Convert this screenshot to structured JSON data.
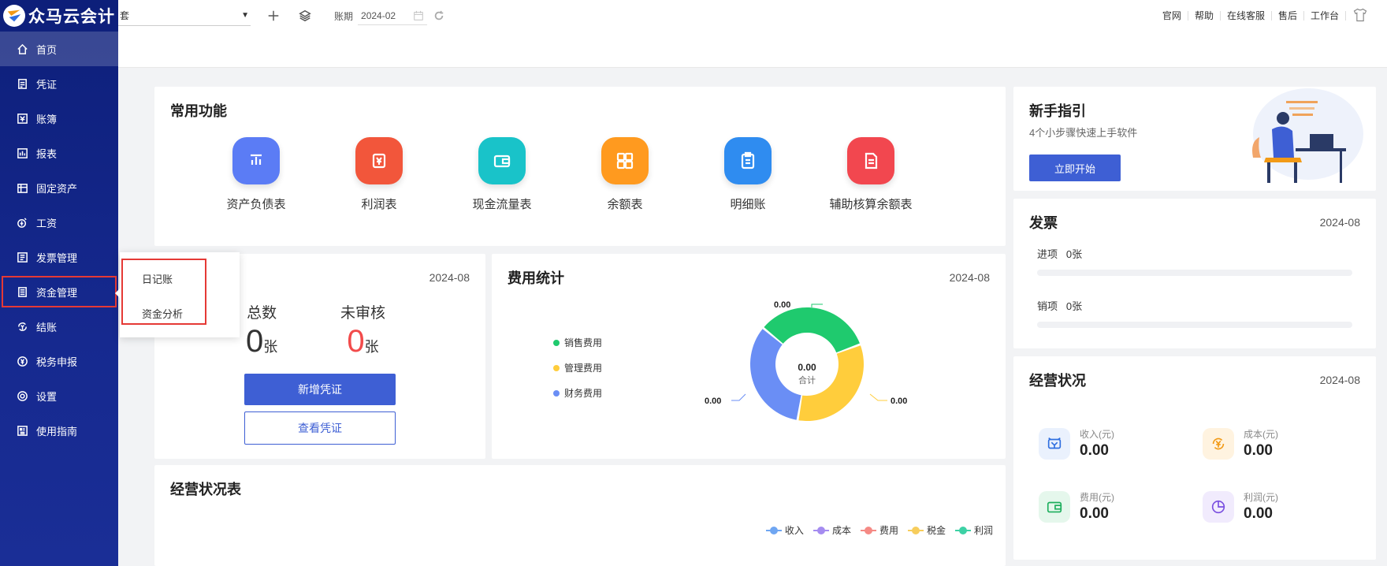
{
  "app": {
    "brand": "众马云会计"
  },
  "sidebar": {
    "items": [
      {
        "label": "首页",
        "icon": "home-icon"
      },
      {
        "label": "凭证",
        "icon": "voucher-icon"
      },
      {
        "label": "账簿",
        "icon": "ledger-icon"
      },
      {
        "label": "报表",
        "icon": "report-icon"
      },
      {
        "label": "固定资产",
        "icon": "fixed-asset-icon"
      },
      {
        "label": "工资",
        "icon": "salary-icon"
      },
      {
        "label": "发票管理",
        "icon": "invoice-icon"
      },
      {
        "label": "资金管理",
        "icon": "fund-icon"
      },
      {
        "label": "结账",
        "icon": "checkout-icon"
      },
      {
        "label": "税务申报",
        "icon": "tax-icon"
      },
      {
        "label": "设置",
        "icon": "gear-icon"
      },
      {
        "label": "使用指南",
        "icon": "guide-icon"
      }
    ]
  },
  "topbar": {
    "account_select_value": "套",
    "period_label": "账期",
    "period_value": "2024-02",
    "links": [
      "官网",
      "帮助",
      "在线客服",
      "售后",
      "工作台"
    ]
  },
  "popup": {
    "items": [
      "日记账",
      "资金分析"
    ]
  },
  "common": {
    "title": "常用功能",
    "functions": [
      {
        "label": "资产负债表",
        "color": "#5b7cf5"
      },
      {
        "label": "利润表",
        "color": "#f2563b"
      },
      {
        "label": "现金流量表",
        "color": "#19c3c9"
      },
      {
        "label": "余额表",
        "color": "#ff9a1f"
      },
      {
        "label": "明细账",
        "color": "#2f8cf0"
      },
      {
        "label": "辅助核算余额表",
        "color": "#f2474f"
      }
    ]
  },
  "guide": {
    "title": "新手指引",
    "subtitle": "4个小步骤快速上手软件",
    "button": "立即开始"
  },
  "invoice": {
    "title": "发票",
    "date": "2024-08",
    "rows": [
      {
        "label": "进项",
        "value": "0张"
      },
      {
        "label": "销项",
        "value": "0张"
      }
    ]
  },
  "biz": {
    "title": "经营状况",
    "date": "2024-08",
    "items": [
      {
        "label": "收入(元)",
        "value": "0.00",
        "icon": "income-icon",
        "color": "#2f6fe0",
        "bg": "#eaf1fd"
      },
      {
        "label": "成本(元)",
        "value": "0.00",
        "icon": "cost-icon",
        "color": "#f29a16",
        "bg": "#fff3e0"
      },
      {
        "label": "费用(元)",
        "value": "0.00",
        "icon": "wallet-icon",
        "color": "#1cae5c",
        "bg": "#e5f7ec"
      },
      {
        "label": "利润(元)",
        "value": "0.00",
        "icon": "profit-icon",
        "color": "#7a4fe0",
        "bg": "#f1ebfd"
      }
    ]
  },
  "voucher": {
    "date": "2024-08",
    "total_label": "总数",
    "total_value": "0",
    "total_unit": "张",
    "unaudited_label": "未审核",
    "unaudited_value": "0",
    "unaudited_unit": "张",
    "new_button": "新增凭证",
    "view_button": "查看凭证"
  },
  "expense": {
    "title": "费用统计",
    "date": "2024-08",
    "legend": [
      {
        "label": "销售费用",
        "color": "#1fca6e"
      },
      {
        "label": "管理费用",
        "color": "#ffcd3c"
      },
      {
        "label": "财务费用",
        "color": "#6a8ef5"
      }
    ],
    "center_value": "0.00",
    "center_label": "合计",
    "slice_labels": [
      "0.00",
      "0.00",
      "0.00"
    ]
  },
  "ops": {
    "title": "经营状况表",
    "legend": [
      {
        "label": "收入",
        "color": "#6fa6f2"
      },
      {
        "label": "成本",
        "color": "#a58cf0"
      },
      {
        "label": "费用",
        "color": "#f58a85"
      },
      {
        "label": "税金",
        "color": "#f7cd5c"
      },
      {
        "label": "利润",
        "color": "#3dd1a5"
      }
    ]
  },
  "chart_data": {
    "type": "pie",
    "categories": [
      "销售费用",
      "管理费用",
      "财务费用"
    ],
    "values": [
      0,
      0,
      0
    ],
    "total": 0
  }
}
